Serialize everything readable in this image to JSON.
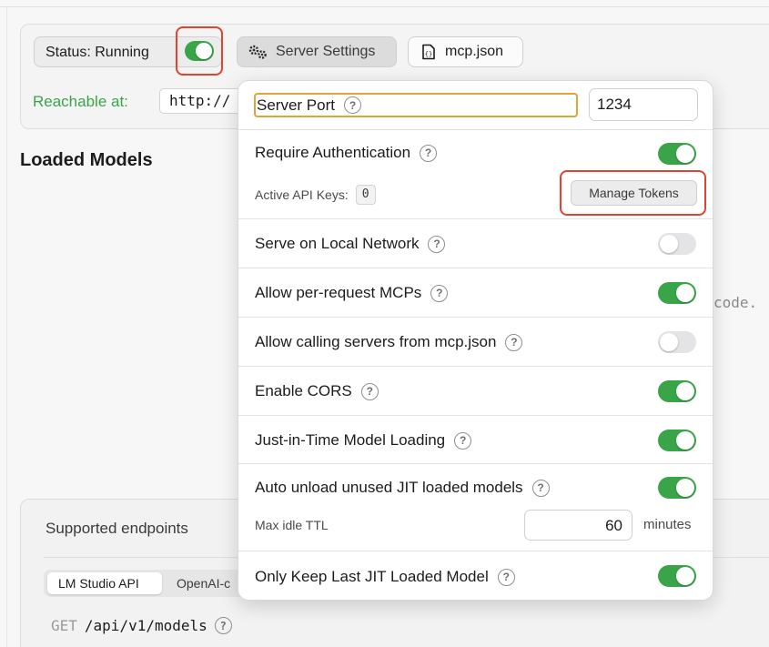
{
  "status": {
    "label": "Status: Running",
    "running": true
  },
  "toolbar": {
    "settings_label": "Server Settings",
    "settings_icon": "gears-icon",
    "mcp_label": "mcp.json",
    "mcp_icon": "json-file-icon"
  },
  "reachable": {
    "label": "Reachable at:",
    "url": "http://"
  },
  "loaded_models": {
    "title": "Loaded Models",
    "code_hint": "code."
  },
  "endpoints": {
    "title": "Supported endpoints",
    "tabs": [
      "LM Studio API",
      "OpenAI-c"
    ],
    "row": {
      "method": "GET",
      "path": "/api/v1/models"
    }
  },
  "settings": {
    "server_port": {
      "label": "Server Port",
      "value": "1234"
    },
    "require_auth": {
      "label": "Require Authentication",
      "enabled": true
    },
    "api_keys": {
      "label": "Active API Keys:",
      "count": "0",
      "manage_label": "Manage Tokens"
    },
    "local_network": {
      "label": "Serve on Local Network",
      "enabled": false
    },
    "per_request_mcps": {
      "label": "Allow per-request MCPs",
      "enabled": true
    },
    "mcp_json_calls": {
      "label": "Allow calling servers from mcp.json",
      "enabled": false
    },
    "cors": {
      "label": "Enable CORS",
      "enabled": true
    },
    "jit_loading": {
      "label": "Just-in-Time Model Loading",
      "enabled": true
    },
    "auto_unload": {
      "label": "Auto unload unused JIT loaded models",
      "enabled": true
    },
    "max_idle_ttl": {
      "label": "Max idle TTL",
      "value": "60",
      "unit": "minutes"
    },
    "keep_last_jit": {
      "label": "Only Keep Last JIT Loaded Model",
      "enabled": true
    }
  },
  "colors": {
    "toggle_on": "#3aa548",
    "toggle_off": "#e4e4e6",
    "highlight_red": "#e0432e",
    "focus_orange": "#e0a43a",
    "link_green": "#3aa548"
  }
}
